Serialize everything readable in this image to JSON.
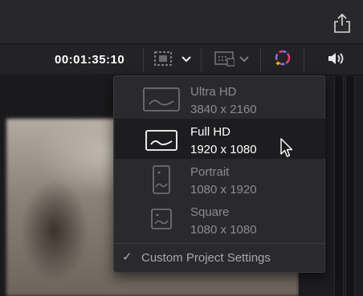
{
  "header": {
    "share_icon": "share-icon"
  },
  "toolbar": {
    "timecode": "00:01:35:10",
    "safe_area_icon": "safe-area-icon",
    "display_mode_icon": "display-mode-icon",
    "color_icon": "color-wheel-icon",
    "audio_icon": "speaker-icon"
  },
  "resolution_menu": {
    "items": [
      {
        "title": "Ultra HD",
        "subtitle": "3840 x 2160",
        "icon": "landscape-frame-icon",
        "state": "disabled"
      },
      {
        "title": "Full HD",
        "subtitle": "1920 x 1080",
        "icon": "landscape-frame-icon",
        "state": "highlighted"
      },
      {
        "title": "Portrait",
        "subtitle": "1080 x 1920",
        "icon": "portrait-frame-icon",
        "state": "disabled"
      },
      {
        "title": "Square",
        "subtitle": "1080 x 1080",
        "icon": "square-frame-icon",
        "state": "disabled"
      }
    ],
    "custom": {
      "check": "✓",
      "label": "Custom Project Settings",
      "checked": true
    }
  },
  "colors": {
    "highlight_text": "#ffffff",
    "dim_text": "#8c8c90",
    "menu_bg": "#2a2a2d",
    "selected_bg": "#1d1d20"
  }
}
